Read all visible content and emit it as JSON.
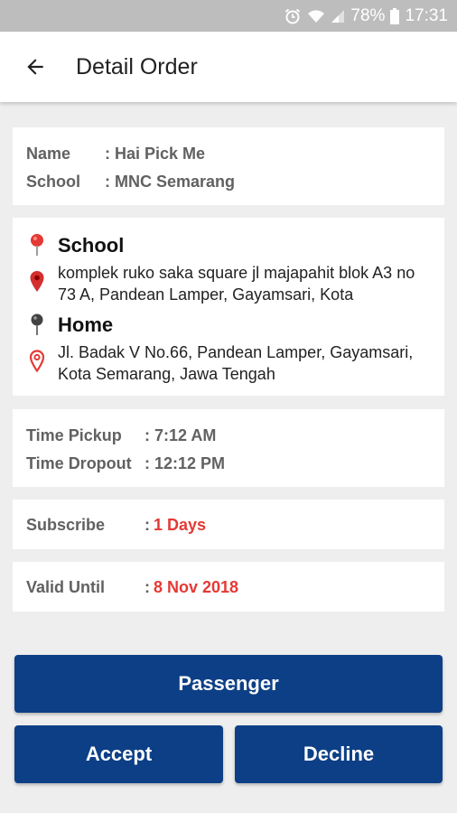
{
  "status_bar": {
    "battery": "78%",
    "time": "17:31",
    "icons": [
      "alarm-icon",
      "wifi-icon",
      "signal-icon",
      "battery-icon"
    ]
  },
  "app_bar": {
    "title": "Detail Order",
    "back_icon": "arrow-back-icon"
  },
  "info": {
    "name_label": "Name",
    "name_value": ": Hai Pick Me",
    "school_label": "School",
    "school_value": ": MNC Semarang"
  },
  "locations": {
    "school_title": "School",
    "school_address": "komplek ruko saka square jl majapahit blok A3 no 73 A, Pandean Lamper, Gayamsari, Kota",
    "home_title": "Home",
    "home_address": "Jl. Badak V No.66, Pandean Lamper, Gayamsari, Kota Semarang, Jawa Tengah"
  },
  "times": {
    "pickup_label": "Time Pickup",
    "pickup_value": ": 7:12 AM",
    "dropout_label": "Time Dropout",
    "dropout_value": ": 12:12 PM"
  },
  "subscribe": {
    "label": "Subscribe",
    "colon": ":",
    "value": "1 Days"
  },
  "valid": {
    "label": "Valid Until",
    "colon": ":",
    "value": "8 Nov 2018"
  },
  "buttons": {
    "passenger": "Passenger",
    "accept": "Accept",
    "decline": "Decline"
  },
  "colors": {
    "primary": "#0d3f86",
    "accent_red": "#e53935"
  }
}
